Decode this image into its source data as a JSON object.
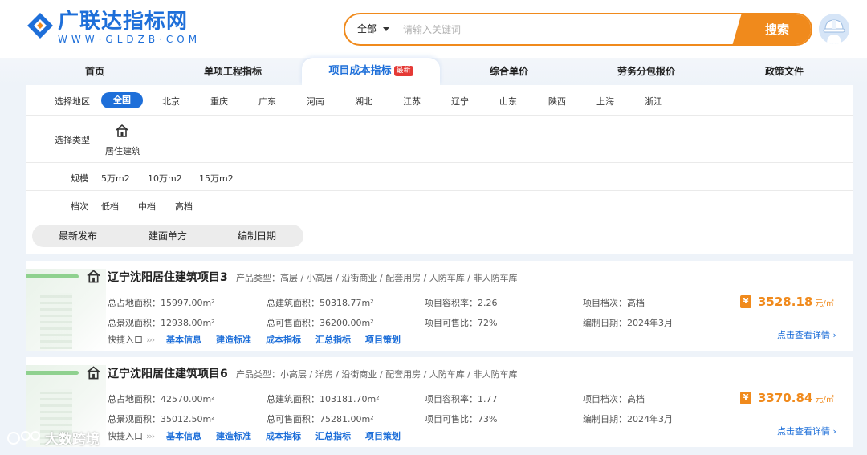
{
  "header": {
    "logo_title": "广联达指标网",
    "logo_url": "WWW·GLDZB·COM",
    "search": {
      "scope": "全部",
      "placeholder": "请输入关键词",
      "button": "搜索"
    }
  },
  "nav": {
    "items": [
      {
        "label": "首页"
      },
      {
        "label": "单项工程指标"
      },
      {
        "label": "项目成本指标",
        "badge": "最新"
      },
      {
        "label": "综合单价"
      },
      {
        "label": "劳务分包报价"
      },
      {
        "label": "政策文件"
      }
    ]
  },
  "filters": {
    "region_label": "选择地区",
    "regions": [
      "全国",
      "北京",
      "重庆",
      "广东",
      "河南",
      "湖北",
      "江苏",
      "辽宁",
      "山东",
      "陕西",
      "上海",
      "浙江"
    ],
    "type_label": "选择类型",
    "type_option": "居住建筑",
    "scale_label": "规模",
    "scales": [
      "5万m2",
      "10万m2",
      "15万m2"
    ],
    "grade_label": "档次",
    "grades": [
      "低档",
      "中档",
      "高档"
    ]
  },
  "sort": {
    "items": [
      "最新发布",
      "建面单方",
      "编制日期"
    ]
  },
  "cards": [
    {
      "title": "辽宁沈阳居住建筑项目3",
      "product_type": "产品类型：高层 / 小高层 / 沿街商业 / 配套用房 / 人防车库 / 非人防车库",
      "land_area": "总占地面积：15997.00m²",
      "build_area": "总建筑面积：50318.77m²",
      "far": "项目容积率：2.26",
      "grade": "项目档次：高档",
      "landscape_area": "总景观面积：12938.00m²",
      "sale_area": "总可售面积：36200.00m²",
      "sale_ratio": "项目可售比：72%",
      "date": "编制日期：2024年3月",
      "price": "3528.18",
      "price_unit": "元/㎡",
      "quick_label": "快捷入口",
      "quick_links": [
        "基本信息",
        "建造标准",
        "成本指标",
        "汇总指标",
        "项目策划"
      ],
      "detail": "点击查看详情 ›"
    },
    {
      "title": "辽宁沈阳居住建筑项目6",
      "product_type": "产品类型：小高层 / 洋房 / 沿街商业 / 配套用房 / 人防车库 / 非人防车库",
      "land_area": "总占地面积：42570.00m²",
      "build_area": "总建筑面积：103181.70m²",
      "far": "项目容积率：1.77",
      "grade": "项目档次：高档",
      "landscape_area": "总景观面积：35012.50m²",
      "sale_area": "总可售面积：75281.00m²",
      "sale_ratio": "项目可售比：73%",
      "date": "编制日期：2024年3月",
      "price": "3370.84",
      "price_unit": "元/㎡",
      "quick_label": "快捷入口",
      "quick_links": [
        "基本信息",
        "建造标准",
        "成本指标",
        "汇总指标",
        "项目策划"
      ],
      "detail": "点击查看详情 ›"
    }
  ],
  "price_icon": "¥",
  "watermark": "大数跨境",
  "colors": {
    "brand_blue": "#1e6fd9",
    "accent_orange": "#f08a1c",
    "new_badge": "#e53935"
  }
}
